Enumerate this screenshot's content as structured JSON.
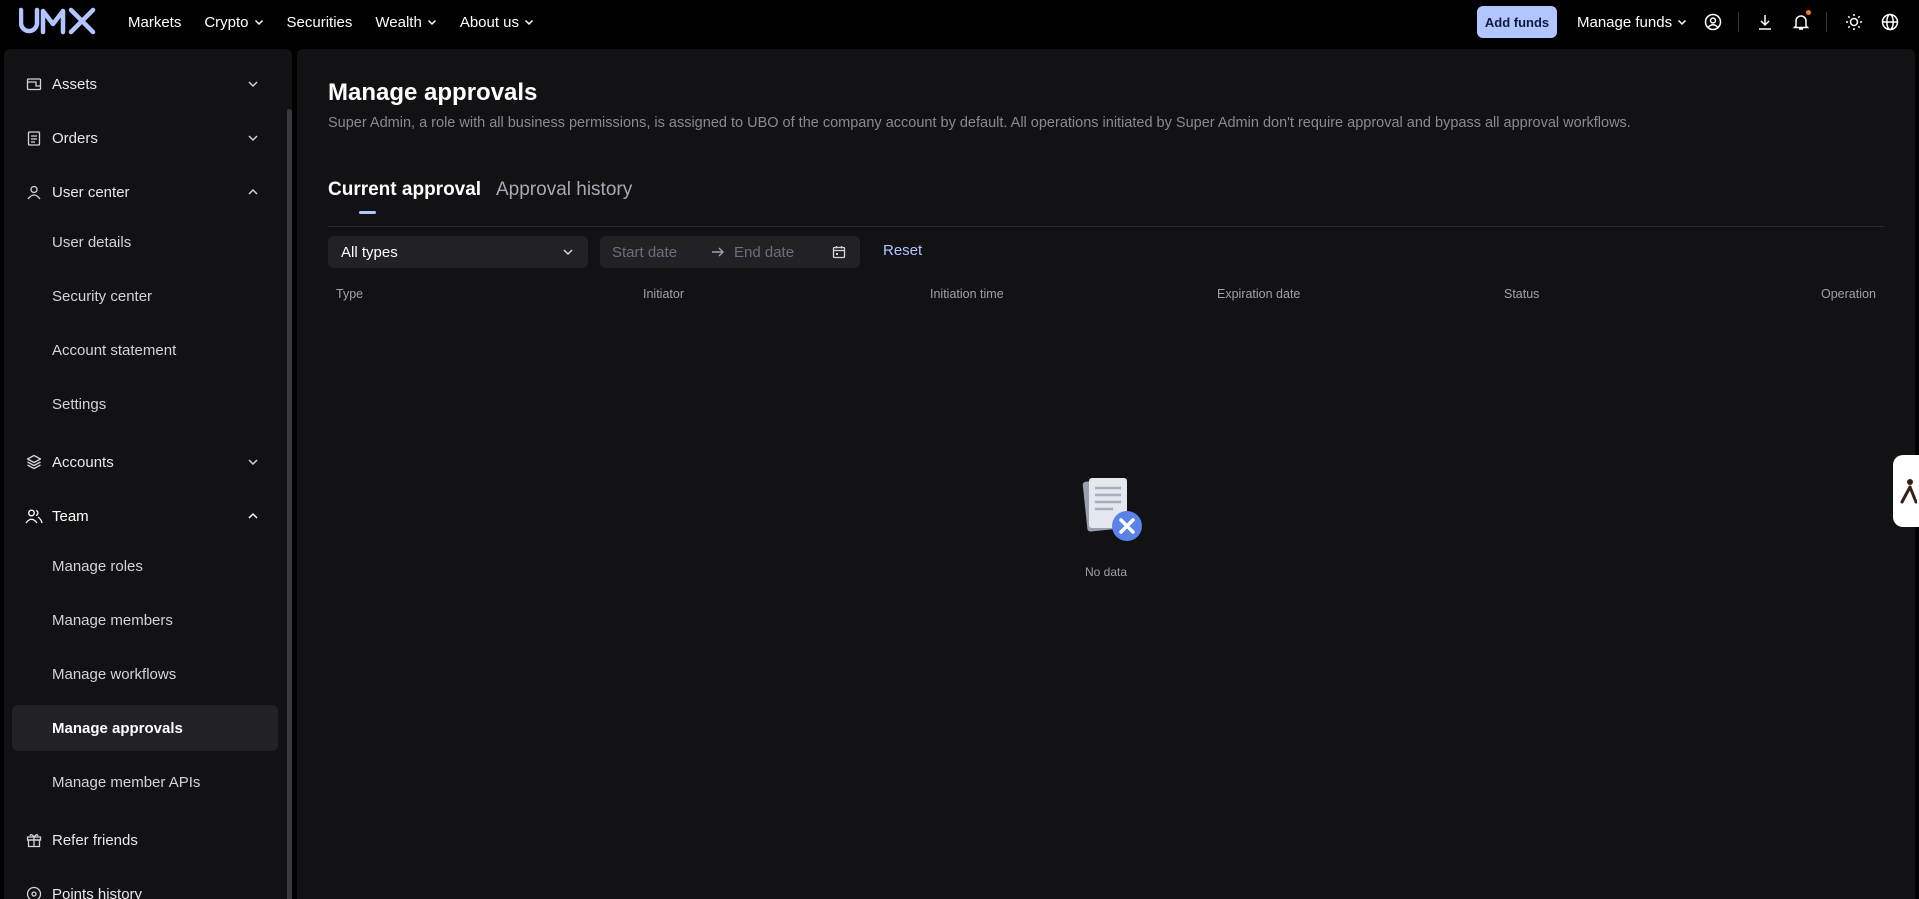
{
  "brand": {
    "logo_text": "UMX"
  },
  "topnav": {
    "items": [
      {
        "label": "Markets",
        "has_dropdown": false
      },
      {
        "label": "Crypto",
        "has_dropdown": true
      },
      {
        "label": "Securities",
        "has_dropdown": false
      },
      {
        "label": "Wealth",
        "has_dropdown": true
      },
      {
        "label": "About us",
        "has_dropdown": true
      }
    ],
    "add_funds": "Add funds",
    "manage_funds": "Manage funds",
    "icons": [
      "user-icon",
      "download-icon",
      "bell-icon",
      "sun-icon",
      "globe-icon"
    ]
  },
  "sidebar": {
    "items": [
      {
        "label": "Assets",
        "icon": "wallet-icon",
        "expanded": false
      },
      {
        "label": "Orders",
        "icon": "clipboard-icon",
        "expanded": false
      },
      {
        "label": "User center",
        "icon": "user-icon",
        "expanded": true
      },
      {
        "label": "User details"
      },
      {
        "label": "Security center"
      },
      {
        "label": "Account statement"
      },
      {
        "label": "Settings"
      },
      {
        "label": "Accounts",
        "icon": "layers-icon",
        "expanded": false
      },
      {
        "label": "Team",
        "icon": "team-icon",
        "expanded": true
      },
      {
        "label": "Manage roles"
      },
      {
        "label": "Manage members"
      },
      {
        "label": "Manage workflows"
      },
      {
        "label": "Manage approvals",
        "active": true
      },
      {
        "label": "Manage member APIs"
      },
      {
        "label": "Refer friends",
        "icon": "gift-icon"
      },
      {
        "label": "Points history",
        "icon": "points-icon"
      }
    ]
  },
  "main": {
    "title": "Manage approvals",
    "description": "Super Admin, a role with all business permissions, is assigned to UBO of the company account by default. All operations initiated by Super Admin don't require approval and bypass all approval workflows.",
    "tabs": [
      {
        "label": "Current approval",
        "active": true
      },
      {
        "label": "Approval history",
        "active": false
      }
    ],
    "filters": {
      "type_value": "All types",
      "start_placeholder": "Start date",
      "end_placeholder": "End date",
      "reset": "Reset"
    },
    "table": {
      "columns": [
        "Type",
        "Initiator",
        "Initiation time",
        "Expiration date",
        "Status",
        "Operation"
      ]
    },
    "empty_text": "No data"
  },
  "colors": {
    "accent": "#b3c5ff",
    "background": "#000000",
    "panel": "#121214",
    "notification_dot": "#ff7a1a"
  }
}
